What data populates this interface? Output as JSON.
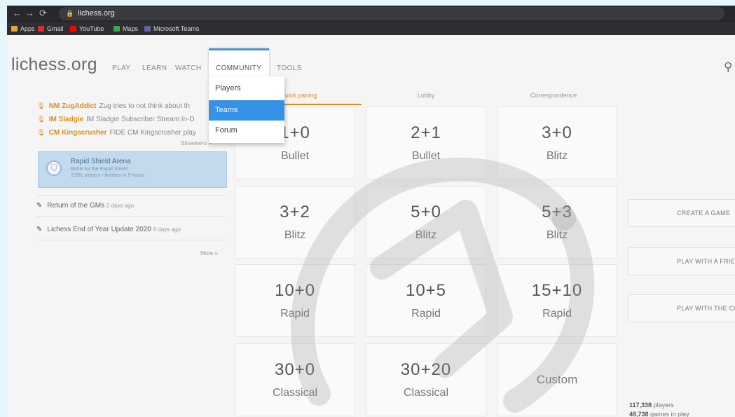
{
  "browser": {
    "url": "lichess.org",
    "bookmarks": [
      {
        "label": "Apps",
        "color": "#e8a33d"
      },
      {
        "label": "Gmail",
        "color": "#d93025"
      },
      {
        "label": "YouTube",
        "color": "#ff0000"
      },
      {
        "label": "Maps",
        "color": "#34a853"
      },
      {
        "label": "Microsoft Teams",
        "color": "#6264a7"
      }
    ]
  },
  "site": {
    "logo": "lichess.org",
    "nav": [
      "PLAY",
      "LEARN",
      "WATCH",
      "COMMUNITY",
      "TOOLS"
    ],
    "community_menu": [
      "Players",
      "Teams",
      "Forum"
    ],
    "active_menu_item": "Teams"
  },
  "streamers": [
    {
      "name": "NM ZugAddict",
      "text": "Zug tries to not think about th"
    },
    {
      "name": "IM Sladgie",
      "text": "IM Sladgie Subscriber Stream In-D"
    },
    {
      "name": "CM Kingscrusher",
      "text": "FIDE CM Kingscrusher play"
    }
  ],
  "streamers_link": "Streamers »",
  "tournament": {
    "name": "Rapid Shield Arena",
    "desc": "Battle for the Rapid Shield",
    "players": "3,551 players",
    "status": "finishes",
    "time": "in 5 hours"
  },
  "blog": [
    {
      "title": "Return of the GMs",
      "ago": "2 days ago"
    },
    {
      "title": "Lichess End of Year Update 2020",
      "ago": "6 days ago"
    }
  ],
  "more_link": "More »",
  "tabs": [
    "Quick pairing",
    "Lobby",
    "Correspondence"
  ],
  "pools": [
    {
      "clock": "1+0",
      "perf": "Bullet"
    },
    {
      "clock": "2+1",
      "perf": "Bullet"
    },
    {
      "clock": "3+0",
      "perf": "Blitz"
    },
    {
      "clock": "3+2",
      "perf": "Blitz"
    },
    {
      "clock": "5+0",
      "perf": "Blitz"
    },
    {
      "clock": "5+3",
      "perf": "Blitz"
    },
    {
      "clock": "10+0",
      "perf": "Rapid"
    },
    {
      "clock": "10+5",
      "perf": "Rapid"
    },
    {
      "clock": "15+10",
      "perf": "Rapid"
    },
    {
      "clock": "30+0",
      "perf": "Classical"
    },
    {
      "clock": "30+20",
      "perf": "Classical"
    },
    {
      "clock": "",
      "perf": "Custom"
    }
  ],
  "actions": [
    "CREATE A GAME",
    "PLAY WITH A FRIEND",
    "PLAY WITH THE COMPUTER"
  ],
  "counters": {
    "players": "117,338",
    "players_label": "players",
    "games": "48,738",
    "games_label": "games in play"
  },
  "colors": {
    "accent": "#d59120",
    "link": "#3692e7",
    "tournament_bg": "#c3d9ec"
  }
}
